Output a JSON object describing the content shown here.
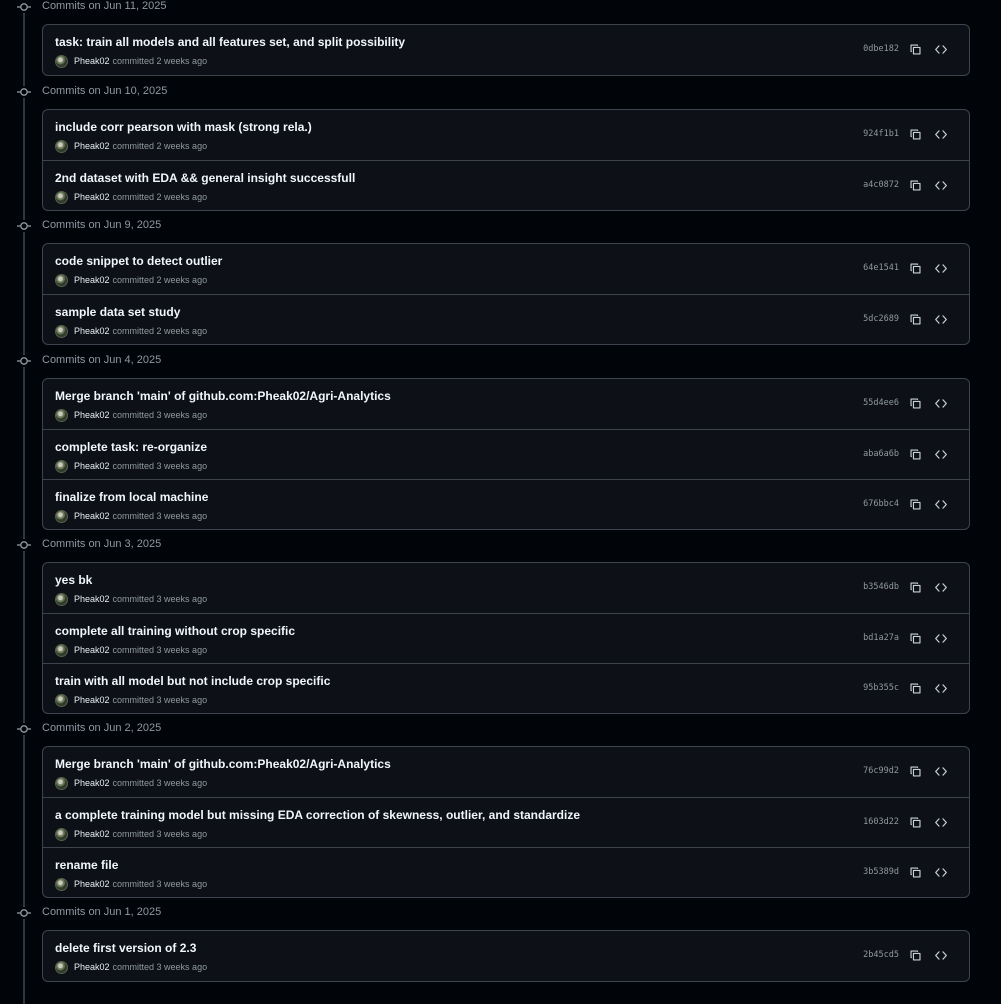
{
  "groups": [
    {
      "date": "Commits on Jun 11, 2025",
      "commits": [
        {
          "message": "task: train all models and all features set, and split possibility",
          "author": "Pheak02",
          "committed": "committed 2 weeks ago",
          "sha": "0dbe182"
        }
      ]
    },
    {
      "date": "Commits on Jun 10, 2025",
      "commits": [
        {
          "message": "include corr pearson with mask (strong rela.)",
          "author": "Pheak02",
          "committed": "committed 2 weeks ago",
          "sha": "924f1b1"
        },
        {
          "message": "2nd dataset with EDA && general insight successfull",
          "author": "Pheak02",
          "committed": "committed 2 weeks ago",
          "sha": "a4c0872"
        }
      ]
    },
    {
      "date": "Commits on Jun 9, 2025",
      "commits": [
        {
          "message": "code snippet to detect outlier",
          "author": "Pheak02",
          "committed": "committed 2 weeks ago",
          "sha": "64e1541"
        },
        {
          "message": "sample data set study",
          "author": "Pheak02",
          "committed": "committed 2 weeks ago",
          "sha": "5dc2689"
        }
      ]
    },
    {
      "date": "Commits on Jun 4, 2025",
      "commits": [
        {
          "message": "Merge branch 'main' of github.com:Pheak02/Agri-Analytics",
          "author": "Pheak02",
          "committed": "committed 3 weeks ago",
          "sha": "55d4ee6"
        },
        {
          "message": "complete task: re-organize",
          "author": "Pheak02",
          "committed": "committed 3 weeks ago",
          "sha": "aba6a6b"
        },
        {
          "message": "finalize from local machine",
          "author": "Pheak02",
          "committed": "committed 3 weeks ago",
          "sha": "676bbc4"
        }
      ]
    },
    {
      "date": "Commits on Jun 3, 2025",
      "commits": [
        {
          "message": "yes bk",
          "author": "Pheak02",
          "committed": "committed 3 weeks ago",
          "sha": "b3546db"
        },
        {
          "message": "complete all training without crop specific",
          "author": "Pheak02",
          "committed": "committed 3 weeks ago",
          "sha": "bd1a27a"
        },
        {
          "message": "train with all model but not include crop specific",
          "author": "Pheak02",
          "committed": "committed 3 weeks ago",
          "sha": "95b355c"
        }
      ]
    },
    {
      "date": "Commits on Jun 2, 2025",
      "commits": [
        {
          "message": "Merge branch 'main' of github.com:Pheak02/Agri-Analytics",
          "author": "Pheak02",
          "committed": "committed 3 weeks ago",
          "sha": "76c99d2"
        },
        {
          "message": "a complete training model but missing EDA correction of skewness, outlier, and standardize",
          "author": "Pheak02",
          "committed": "committed 3 weeks ago",
          "sha": "1603d22"
        },
        {
          "message": "rename file",
          "author": "Pheak02",
          "committed": "committed 3 weeks ago",
          "sha": "3b5389d"
        }
      ]
    },
    {
      "date": "Commits on Jun 1, 2025",
      "commits": [
        {
          "message": "delete first version of 2.3",
          "author": "Pheak02",
          "committed": "committed 3 weeks ago",
          "sha": "2b45cd5"
        }
      ]
    }
  ],
  "icons": {
    "group": "git-commit-icon",
    "copy": "copy-icon",
    "browse": "code-icon"
  },
  "colors": {
    "background": "#010409",
    "card": "#0d1117",
    "border": "#3d444d",
    "muted": "#9198a1",
    "text": "#f0f6fc"
  }
}
